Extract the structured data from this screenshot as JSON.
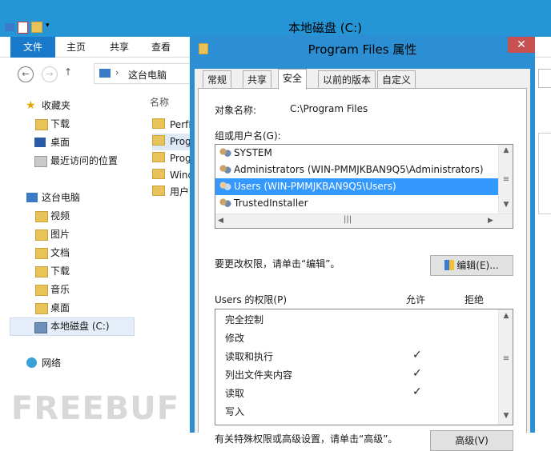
{
  "explorer": {
    "title": "本地磁盘 (C:)",
    "ribbon_tabs": [
      "文件",
      "主页",
      "共享",
      "查看"
    ],
    "address": "这台电脑",
    "column_name": "名称",
    "sidebar": {
      "favorites": "收藏夹",
      "fav_items": [
        "下载",
        "桌面",
        "最近访问的位置"
      ],
      "this_pc": "这台电脑",
      "pc_items": [
        "视频",
        "图片",
        "文档",
        "下载",
        "音乐",
        "桌面",
        "本地磁盘 (C:)"
      ],
      "network": "网络"
    },
    "files": [
      "PerfL",
      "Prog",
      "Prog",
      "Wind",
      "用户"
    ],
    "watermark": "FREEBUF"
  },
  "dialog": {
    "title": "Program Files 属性",
    "tabs": [
      "常规",
      "共享",
      "安全",
      "以前的版本",
      "自定义"
    ],
    "object_label": "对象名称:",
    "object_value": "C:\\Program Files",
    "group_label": "组或用户名(G):",
    "users": [
      "SYSTEM",
      "Administrators (WIN-PMMJKBAN9Q5\\Administrators)",
      "Users (WIN-PMMJKBAN9Q5\\Users)",
      "TrustedInstaller"
    ],
    "change_hint": "要更改权限，请单击“编辑”。",
    "edit_button": "编辑(E)...",
    "perm_header": "Users 的权限(P)",
    "allow": "允许",
    "deny": "拒绝",
    "permissions": [
      {
        "name": "完全控制",
        "allow": ""
      },
      {
        "name": "修改",
        "allow": ""
      },
      {
        "name": "读取和执行",
        "allow": "✓"
      },
      {
        "name": "列出文件夹内容",
        "allow": "✓"
      },
      {
        "name": "读取",
        "allow": "✓"
      },
      {
        "name": "写入",
        "allow": ""
      }
    ],
    "advanced_hint": "有关特殊权限或高级设置，请单击“高级”。",
    "advanced_button": "高级(V)"
  },
  "colors": {
    "accent": "#2c8fd4",
    "selection": "#3399ff",
    "file_tab": "#1979ca",
    "close": "#c75050"
  }
}
